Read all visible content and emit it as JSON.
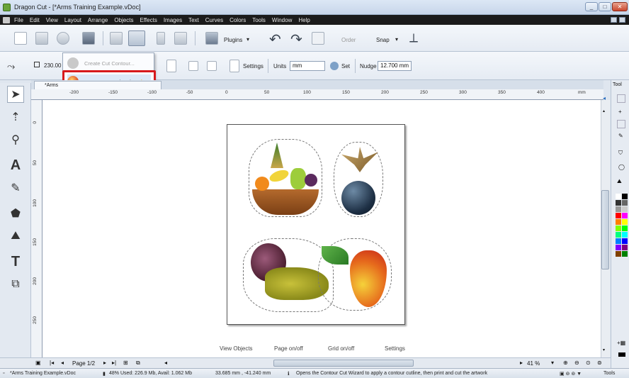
{
  "window": {
    "title": "Dragon Cut - [*Arms Training Example.vDoc]"
  },
  "menu": [
    "File",
    "Edit",
    "View",
    "Layout",
    "Arrange",
    "Objects",
    "Effects",
    "Images",
    "Text",
    "Curves",
    "Colors",
    "Tools",
    "Window",
    "Help"
  ],
  "toolbar1": {
    "plugins_label": "Plugins",
    "order_label": "Order",
    "snap_label": "Snap"
  },
  "toolbar2": {
    "width_value": "230.00",
    "settings_label": "Settings",
    "units_label": "Units",
    "units_value": "mm",
    "set_label": "Set",
    "nudge_label": "Nudge",
    "nudge_value": "12.700 mm"
  },
  "dropdown": {
    "items": [
      "Create Cut Contour...",
      "Contour Cut Wizard..."
    ]
  },
  "tabs": {
    "doc_tab": "*Arms",
    "docker_tab": "Tool"
  },
  "ruler": {
    "h_ticks": [
      "-200",
      "-150",
      "-100",
      "-50",
      "0",
      "50",
      "100",
      "150",
      "200",
      "250",
      "300",
      "350",
      "400"
    ],
    "h_unit": "mm",
    "v_ticks": [
      "0",
      "50",
      "100",
      "150",
      "200",
      "250"
    ]
  },
  "canvas": {
    "bottom_links": [
      "View Objects",
      "Page on/off",
      "Grid on/off",
      "Settings"
    ]
  },
  "nav": {
    "page_label": "Page 1/2",
    "zoom_value": "41 %"
  },
  "statusbar": {
    "file": "*Arms Training Example.vDoc",
    "memory": "48%  Used: 226.9 Mb, Avail: 1.062 Mb",
    "coords": "33.685 mm , -41.240 mm",
    "hint": "Opens the Contour Cut Wizard to apply a contour cutline, then print and cut the artwork",
    "tools_label": "Tools"
  },
  "palette": [
    "#ffffff",
    "#000000",
    "#333333",
    "#666666",
    "#999999",
    "#cccccc",
    "#ff0000",
    "#ff00ff",
    "#ff8000",
    "#ffff00",
    "#80ff00",
    "#00ff00",
    "#00ff80",
    "#00ffff",
    "#0080ff",
    "#0000ff",
    "#8000ff",
    "#800080",
    "#804000",
    "#008000"
  ],
  "colors": {
    "highlight": "#d7191c",
    "menubar": "#1b1b1b"
  }
}
